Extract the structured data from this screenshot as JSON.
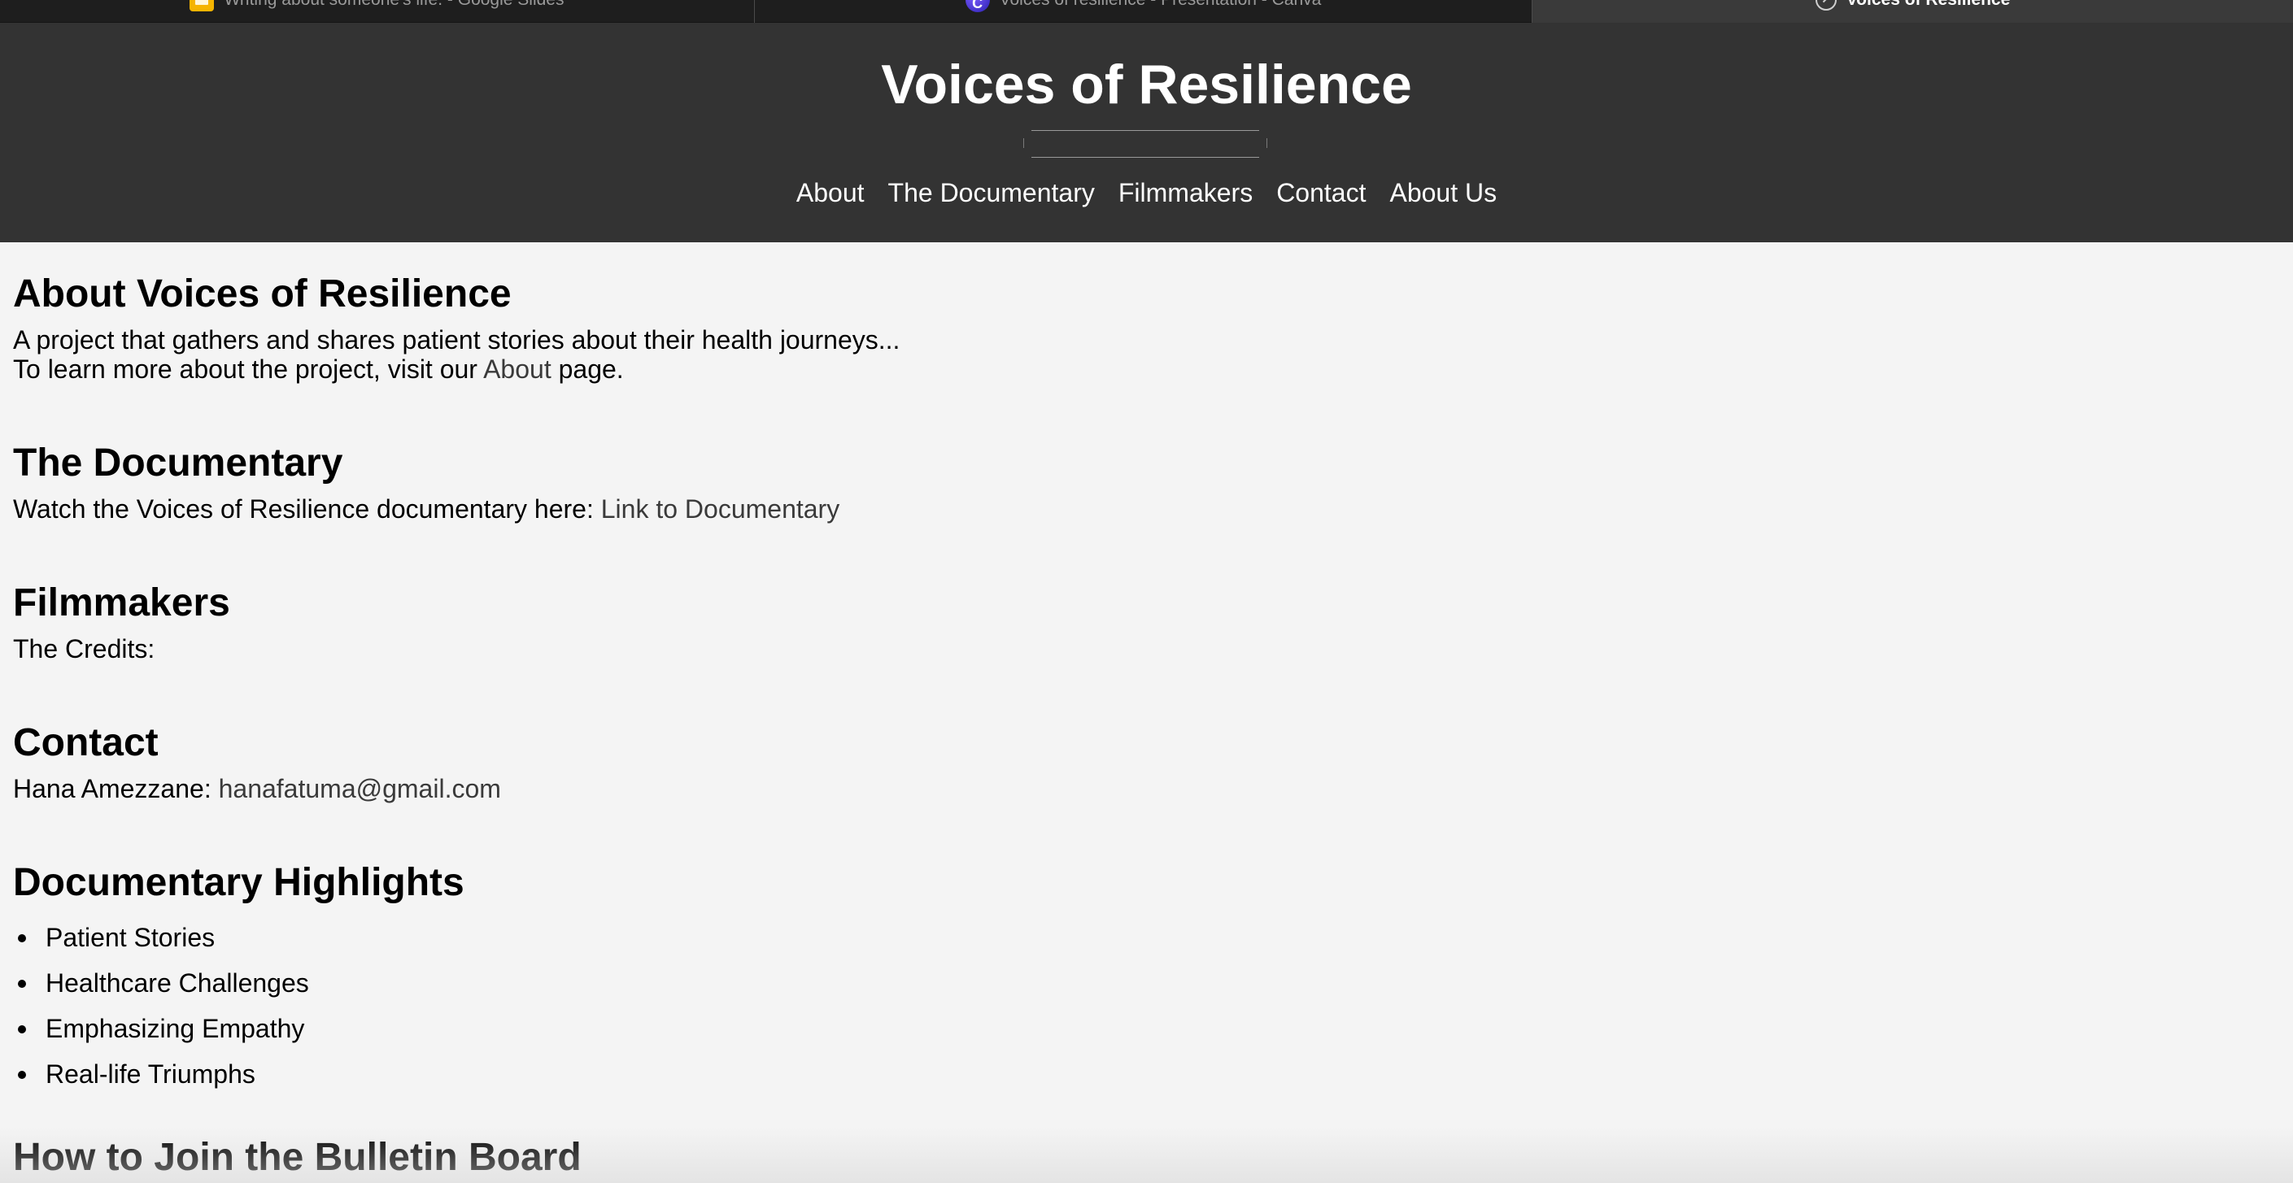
{
  "browser": {
    "tabs": [
      {
        "title": "Writing about someone's life. - Google Slides",
        "icon": "google-slides-icon",
        "active": false
      },
      {
        "title": "Voices of resilience - Presentation - Canva",
        "icon": "canva-icon",
        "active": false
      },
      {
        "title": "Voices of Resilience",
        "icon": "compass-icon",
        "active": true
      }
    ]
  },
  "header": {
    "title": "Voices of Resilience",
    "nav": [
      "About",
      "The Documentary",
      "Filmmakers",
      "Contact",
      "About Us"
    ],
    "background_color": "#333333"
  },
  "sections": {
    "about": {
      "heading": "About Voices of Resilience",
      "line1": "A project that gathers and shares patient stories about their health journeys...",
      "line2_prefix": "To learn more about the project, visit our ",
      "line2_link": "About",
      "line2_suffix": " page."
    },
    "documentary": {
      "heading": "The Documentary",
      "text": "Watch the Voices of Resilience documentary here: ",
      "link": "Link to Documentary"
    },
    "filmmakers": {
      "heading": "Filmmakers",
      "text": "The Credits:"
    },
    "contact": {
      "heading": "Contact",
      "name": "Hana Amezzane: ",
      "email": "hanafatuma@gmail.com"
    },
    "highlights": {
      "heading": "Documentary Highlights",
      "items": [
        "Patient Stories",
        "Healthcare Challenges",
        "Emphasizing Empathy",
        "Real-life Triumphs"
      ]
    },
    "join": {
      "heading": "How to Join the Bulletin Board"
    }
  },
  "colors": {
    "page_background": "#f4f4f4",
    "link": "#3a3a3a"
  }
}
